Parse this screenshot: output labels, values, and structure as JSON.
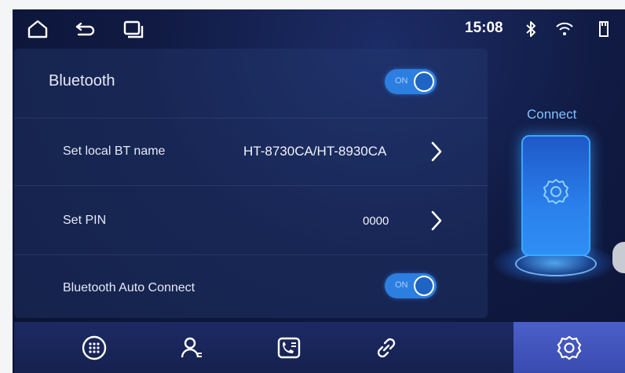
{
  "status_bar": {
    "time": "15:08",
    "icons": [
      "home-icon",
      "back-icon",
      "recent-apps-icon",
      "bluetooth-icon",
      "wifi-icon",
      "sd-card-icon"
    ]
  },
  "bluetooth": {
    "label": "Bluetooth",
    "toggle_text": "ON",
    "enabled": true
  },
  "settings": {
    "bt_name": {
      "label": "Set local BT name",
      "value": "HT-8730CA/HT-8930CA"
    },
    "pin": {
      "label": "Set PIN",
      "value": "0000"
    },
    "auto_connect": {
      "label": "Bluetooth Auto Connect",
      "toggle_text": "ON",
      "enabled": true
    }
  },
  "connect_panel": {
    "label": "Connect"
  },
  "bottom_nav": {
    "items": [
      "dialpad-icon",
      "contacts-icon",
      "call-log-icon",
      "link-icon",
      "settings-icon"
    ],
    "active": "settings-icon"
  },
  "colors": {
    "accent": "#2c7fe0",
    "background": "#101a42",
    "connect_text": "#7fc3ff"
  }
}
